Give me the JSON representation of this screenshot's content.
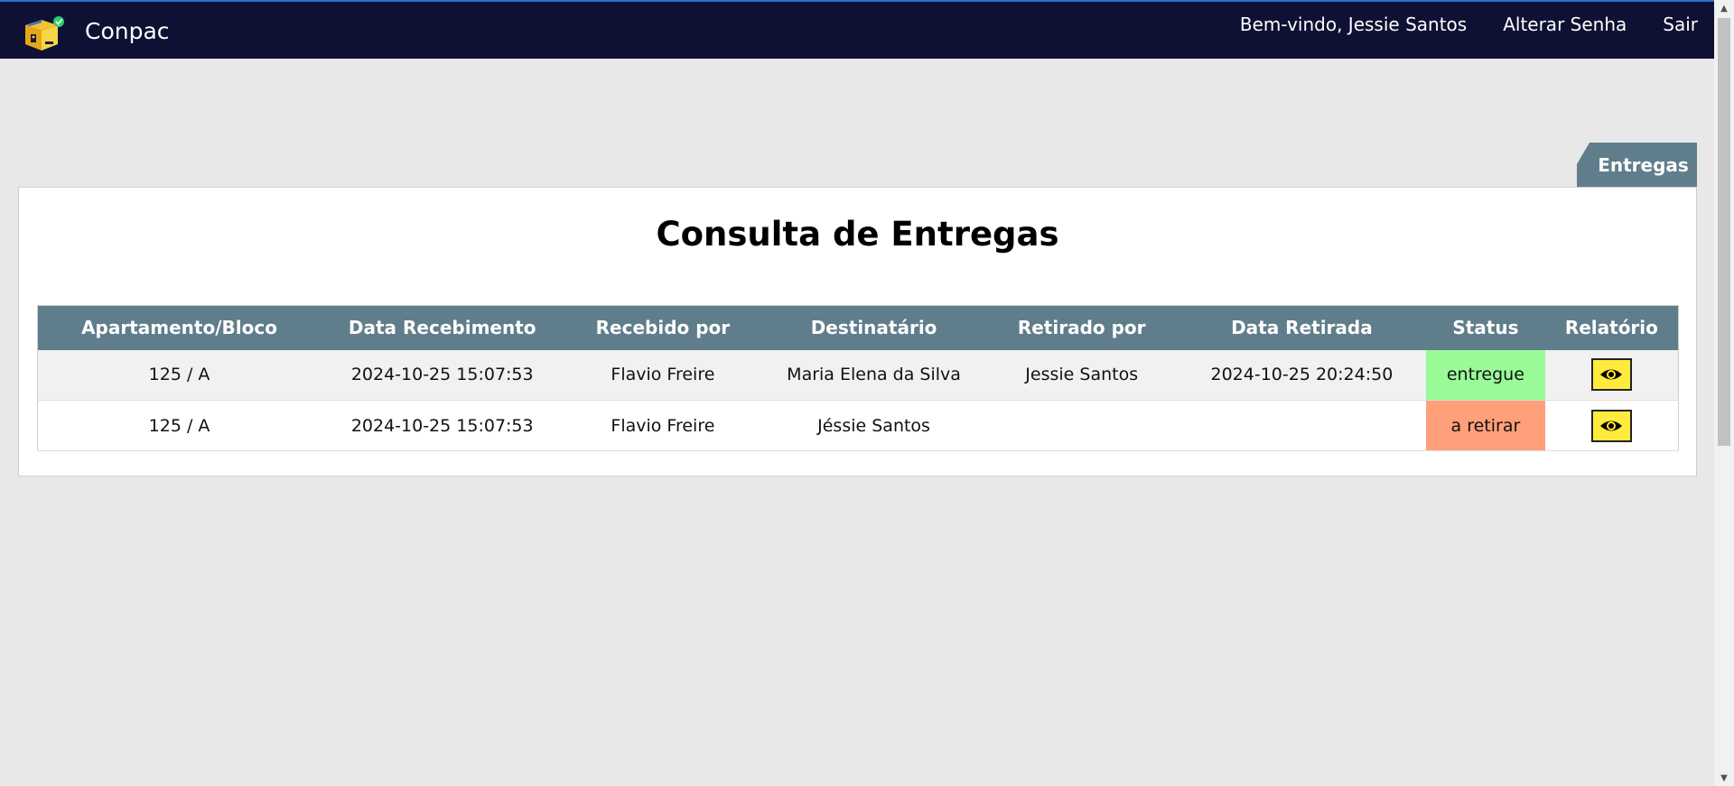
{
  "header": {
    "brand": "Conpac",
    "welcome": "Bem-vindo, Jessie Santos",
    "change_password": "Alterar Senha",
    "logout": "Sair"
  },
  "tab": {
    "label": "Entregas"
  },
  "main": {
    "title": "Consulta de Entregas",
    "columns": [
      "Apartamento/Bloco",
      "Data Recebimento",
      "Recebido por",
      "Destinatário",
      "Retirado por",
      "Data Retirada",
      "Status",
      "Relatório"
    ],
    "rows": [
      {
        "apartment": "125 / A",
        "received_date": "2024-10-25 15:07:53",
        "received_by": "Flavio Freire",
        "recipient": "Maria Elena da Silva",
        "picked_up_by": "Jessie Santos",
        "pickup_date": "2024-10-25 20:24:50",
        "status": "entregue",
        "report_icon": "eye-icon"
      },
      {
        "apartment": "125 / A",
        "received_date": "2024-10-25 15:07:53",
        "received_by": "Flavio Freire",
        "recipient": "Jéssie Santos",
        "picked_up_by": "",
        "pickup_date": "",
        "status": "a retirar",
        "report_icon": "eye-icon"
      }
    ]
  },
  "colors": {
    "topbar": "#0e1133",
    "accent": "#607d8b",
    "status_delivered": "#98fb98",
    "status_pending": "#ffa07a",
    "report_button": "#ffeb3b"
  }
}
